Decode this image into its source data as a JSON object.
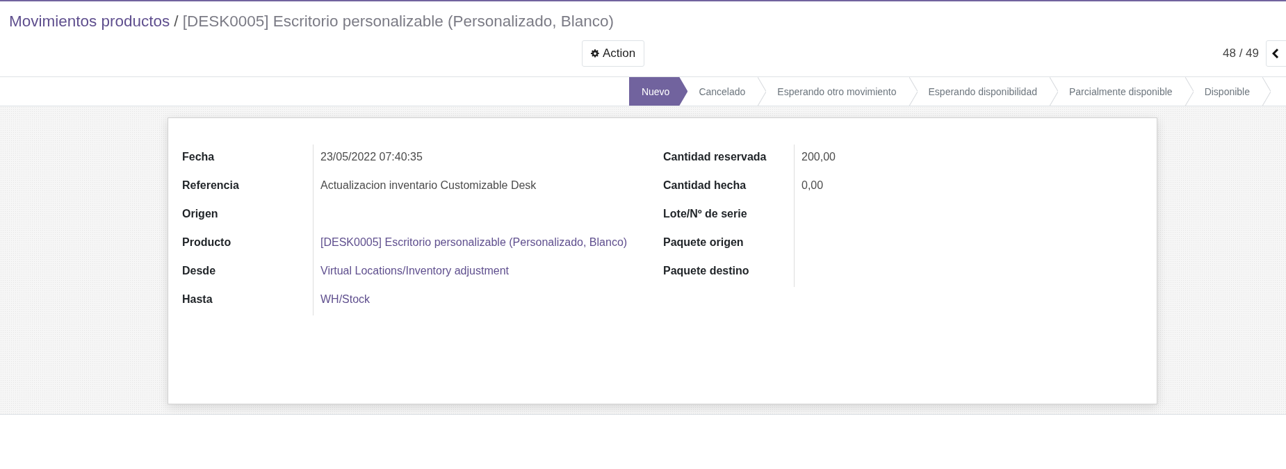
{
  "breadcrumb": {
    "parent": "Movimientos productos",
    "separator": "/",
    "current": "[DESK0005] Escritorio personalizable (Personalizado, Blanco)"
  },
  "action_button": {
    "label": "Action"
  },
  "pager": {
    "text": "48 / 49"
  },
  "statusbar": [
    {
      "label": "Nuevo",
      "selected": true
    },
    {
      "label": "Cancelado",
      "selected": false
    },
    {
      "label": "Esperando otro movimiento",
      "selected": false
    },
    {
      "label": "Esperando disponibilidad",
      "selected": false
    },
    {
      "label": "Parcialmente disponible",
      "selected": false
    },
    {
      "label": "Disponible",
      "selected": false
    }
  ],
  "left_fields": [
    {
      "label": "Fecha",
      "kind": "text",
      "value": "23/05/2022 07:40:35"
    },
    {
      "label": "Referencia",
      "kind": "text",
      "value": "Actualizacion inventario Customizable Desk"
    },
    {
      "label": "Origen",
      "kind": "text"
    },
    {
      "label": "Producto",
      "kind": "link",
      "value": "[DESK0005] Escritorio personalizable (Personalizado, Blanco)"
    },
    {
      "label": "Desde",
      "kind": "link",
      "value": "Virtual Locations/Inventory adjustment"
    },
    {
      "label": "Hasta",
      "kind": "link",
      "value": "WH/Stock"
    }
  ],
  "right_fields": [
    {
      "label": "Cantidad reservada",
      "kind": "text",
      "value": "200,00"
    },
    {
      "label": "Cantidad hecha",
      "kind": "text",
      "value": "0,00"
    },
    {
      "label": "Lote/Nº de serie",
      "kind": "text"
    },
    {
      "label": "Paquete origen",
      "kind": "text"
    },
    {
      "label": "Paquete destino",
      "kind": "text"
    }
  ]
}
